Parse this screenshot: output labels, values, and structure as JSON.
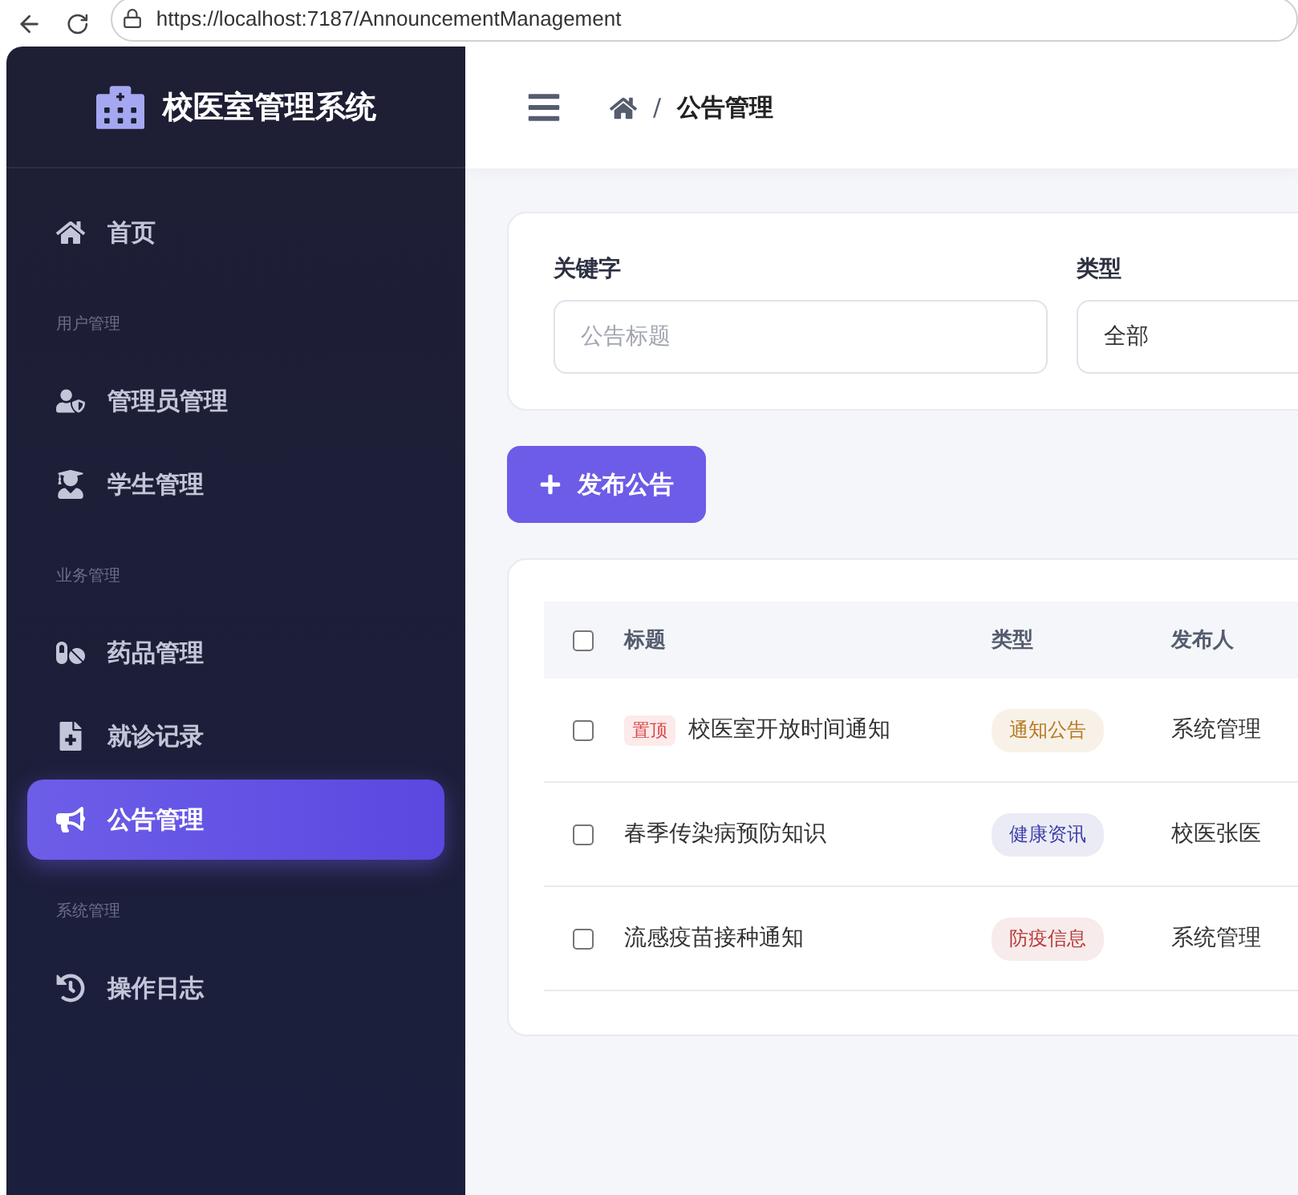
{
  "browser": {
    "url": "https://localhost:7187/AnnouncementManagement"
  },
  "sidebar": {
    "title": "校医室管理系统",
    "items": [
      {
        "kind": "item",
        "label": "首页",
        "selected": false
      },
      {
        "kind": "section",
        "label": "用户管理"
      },
      {
        "kind": "item",
        "label": "管理员管理",
        "selected": false
      },
      {
        "kind": "item",
        "label": "学生管理",
        "selected": false
      },
      {
        "kind": "section",
        "label": "业务管理"
      },
      {
        "kind": "item",
        "label": "药品管理",
        "selected": false
      },
      {
        "kind": "item",
        "label": "就诊记录",
        "selected": false
      },
      {
        "kind": "item",
        "label": "公告管理",
        "selected": true
      },
      {
        "kind": "section",
        "label": "系统管理"
      },
      {
        "kind": "item",
        "label": "操作日志",
        "selected": false
      }
    ]
  },
  "header": {
    "separator": "/",
    "current": "公告管理"
  },
  "filters": [
    {
      "label": "关键字",
      "placeholder": "公告标题"
    },
    {
      "label": "类型",
      "value": "全部"
    }
  ],
  "add_button": "发布公告",
  "table": {
    "select_all": false,
    "columns": [
      "标题",
      "类型",
      "发布人"
    ],
    "rows": [
      {
        "checked": false,
        "badge": "置顶",
        "title": "校医室开放时间通知",
        "type": {
          "label": "通知公告",
          "color": "#b7791f"
        },
        "publisher": "系统管理"
      },
      {
        "checked": false,
        "title": "春季传染病预防知识",
        "type": {
          "label": "健康资讯",
          "color": "#3f3fa8"
        },
        "publisher": "校医张医"
      },
      {
        "checked": false,
        "title": "流感疫苗接种通知",
        "type": {
          "label": "防疫信息",
          "color": "#b83a3a"
        },
        "publisher": "系统管理"
      }
    ]
  }
}
